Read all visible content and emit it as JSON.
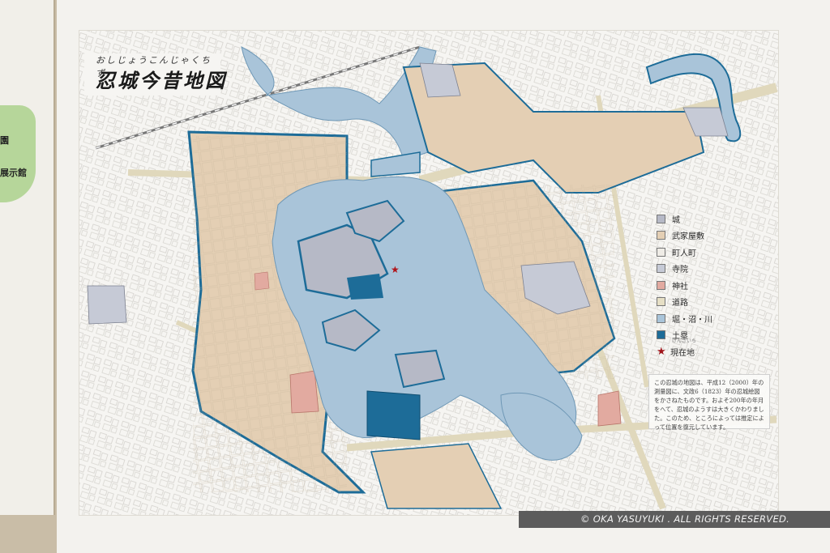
{
  "left_panel": {
    "fragment_top": "園",
    "fragment_bottom": "展示館"
  },
  "title": {
    "ruby": "おしじょうこんじゃくちず",
    "main": "忍城今昔地図"
  },
  "legend": {
    "items": [
      {
        "label": "城",
        "color": "#b6b9c6"
      },
      {
        "label": "武家屋敷",
        "color": "#e4cfb4"
      },
      {
        "label": "町人町",
        "color": "#efece6"
      },
      {
        "label": "寺院",
        "color": "#c6cad6"
      },
      {
        "label": "神社",
        "color": "#e2aaa0"
      },
      {
        "label": "道路",
        "color": "#e6dfc5"
      },
      {
        "label": "堀・沼・川",
        "color": "#a9c4d9"
      },
      {
        "label": "土塁",
        "color": "#1d6c98"
      }
    ],
    "current_location": {
      "label": "現在地",
      "ruby": "げんざいち",
      "color": "#a0141a"
    }
  },
  "note": {
    "text": "この忍城の地図は、平成12（2000）年の測量図に、文政6（1823）年の忍城絵図をかさねたものです。およそ200年の年月をへて、忍城のようすは大きくかわりました。このため、ところによっては推定によって位置を復元しています。"
  },
  "copyright": "© OKA YASUYUKI . ALL RIGHTS RESERVED.",
  "colors": {
    "water": "#a9c4d9",
    "embankment": "#1d6c98",
    "samurai": "#e4cfb4",
    "temple": "#c6cad6",
    "shrine": "#e2aaa0",
    "marker": "#b0141a"
  }
}
